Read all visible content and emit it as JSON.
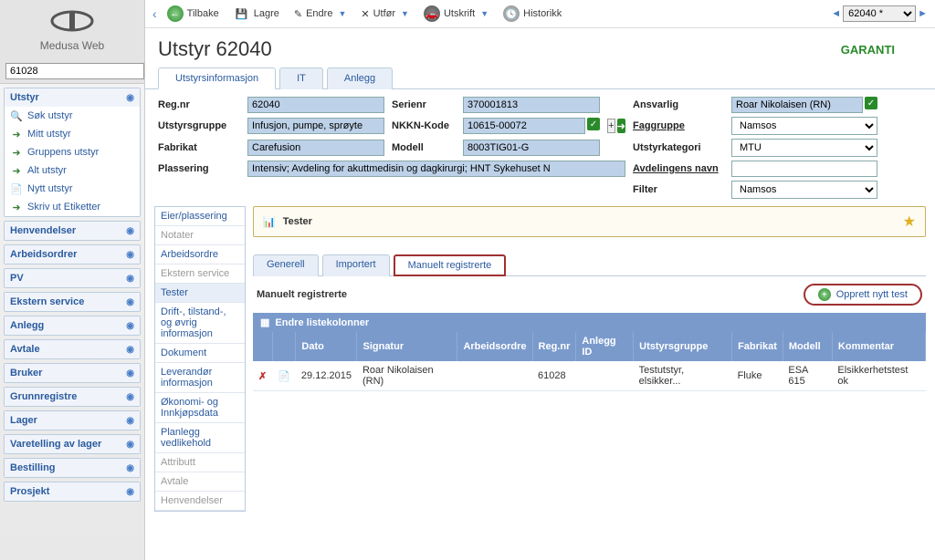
{
  "logo_text": "Medusa Web",
  "sidebar_search_value": "61028",
  "nav": {
    "utstyr": {
      "label": "Utstyr",
      "items": [
        "Søk utstyr",
        "Mitt utstyr",
        "Gruppens utstyr",
        "Alt utstyr",
        "Nytt utstyr",
        "Skriv ut Etiketter"
      ]
    },
    "sections": [
      "Henvendelser",
      "Arbeidsordrer",
      "PV",
      "Ekstern service",
      "Anlegg",
      "Avtale",
      "Bruker",
      "Grunnregistre",
      "Lager",
      "Varetelling av lager",
      "Bestilling",
      "Prosjekt"
    ]
  },
  "toolbar": {
    "back": "Tilbake",
    "save": "Lagre",
    "edit": "Endre",
    "execute": "Utfør",
    "print": "Utskrift",
    "history": "Historikk",
    "nav_value": "62040 *"
  },
  "page": {
    "title": "Utstyr 62040",
    "garanti": "GARANTI"
  },
  "bigtabs": [
    "Utstyrsinformasjon",
    "IT",
    "Anlegg"
  ],
  "info": {
    "reg_nr_lbl": "Reg.nr",
    "reg_nr": "62040",
    "serienr_lbl": "Serienr",
    "serienr": "370001813",
    "ansvarlig_lbl": "Ansvarlig",
    "ansvarlig": "Roar Nikolaisen (RN)",
    "utstyrsgruppe_lbl": "Utstyrsgruppe",
    "utstyrsgruppe": "Infusjon, pumpe, sprøyte",
    "nkkn_lbl": "NKKN-Kode",
    "nkkn": "10615-00072",
    "faggruppe_lbl": "Faggruppe",
    "faggruppe": "Namsos",
    "fabrikat_lbl": "Fabrikat",
    "fabrikat": "Carefusion",
    "modell_lbl": "Modell",
    "modell": "8003TIG01-G",
    "utstyrkategori_lbl": "Utstyrkategori",
    "utstyrkategori": "MTU",
    "plassering_lbl": "Plassering",
    "plassering": "Intensiv; Avdeling for akuttmedisin og dagkirurgi; HNT Sykehuset N",
    "avdeling_lbl": "Avdelingens navn",
    "avdeling": "",
    "filter_lbl": "Filter",
    "filter": "Namsos"
  },
  "subnav": [
    "Eier/plassering",
    "Notater",
    "Arbeidsordre",
    "Ekstern service",
    "Tester",
    "Drift-, tilstand-, og øvrig informasjon",
    "Dokument",
    "Leverandør informasjon",
    "Økonomi- og Innkjøpsdata",
    "Planlegg vedlikehold",
    "Attributt",
    "Avtale",
    "Henvendelser"
  ],
  "tester_header": "Tester",
  "inner_tabs": [
    "Generell",
    "Importert",
    "Manuelt registrerte"
  ],
  "manual_title": "Manuelt registrerte",
  "new_test_label": "Opprett nytt test",
  "grid_config_label": "Endre listekolonner",
  "columns": [
    "",
    "",
    "Dato",
    "Signatur",
    "Arbeidsordre",
    "Reg.nr",
    "Anlegg ID",
    "Utstyrsgruppe",
    "Fabrikat",
    "Modell",
    "Kommentar"
  ],
  "rows": [
    {
      "dato": "29.12.2015",
      "signatur": "Roar Nikolaisen (RN)",
      "arbeidsordre": "",
      "regnr": "61028",
      "anlegg": "",
      "utstyrsgruppe": "Testutstyr, elsikker...",
      "fabrikat": "Fluke",
      "modell": "ESA 615",
      "kommentar": "Elsikkerhetstest ok"
    }
  ]
}
